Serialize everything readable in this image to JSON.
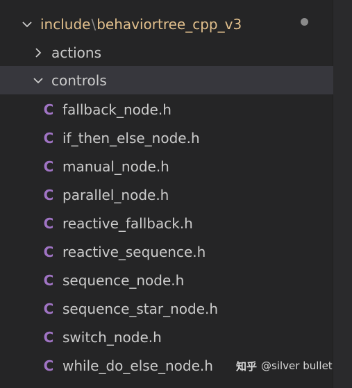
{
  "explorer": {
    "root": {
      "folder": "include",
      "separator": "\\",
      "subfolder": "behaviortree_cpp_v3",
      "expanded": true,
      "modified_indicator": "dot"
    },
    "folders": [
      {
        "label": "actions",
        "expanded": false,
        "icon": "chevron-right-icon"
      },
      {
        "label": "controls",
        "expanded": true,
        "icon": "chevron-down-icon",
        "selected": true
      }
    ],
    "file_icon": {
      "glyph": "C",
      "color": "#a074c4",
      "name": "c-file-icon"
    },
    "files": [
      "fallback_node.h",
      "if_then_else_node.h",
      "manual_node.h",
      "parallel_node.h",
      "reactive_fallback.h",
      "reactive_sequence.h",
      "sequence_node.h",
      "sequence_star_node.h",
      "switch_node.h",
      "while_do_else_node.h"
    ]
  },
  "watermark": {
    "brand": "知乎",
    "author": "@silver bullet"
  },
  "colors": {
    "background": "#252526",
    "selected_row": "#37373d",
    "root_folder_text": "#e2c08d",
    "text": "#cccccc"
  }
}
